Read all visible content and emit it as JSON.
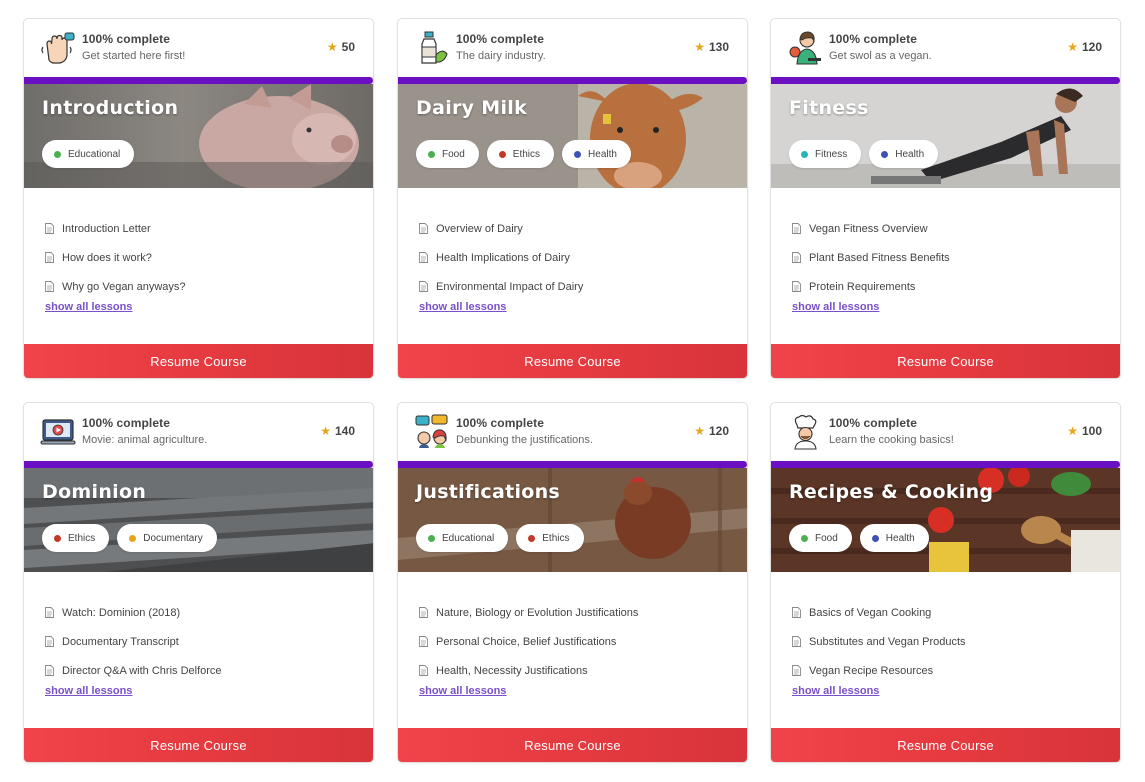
{
  "colors": {
    "progress": "#6b0fc2",
    "resume_button": "#e53a40",
    "star": "#e8a317",
    "link": "#7a4fc9",
    "tag_dots": {
      "Educational": "#4caf50",
      "Food": "#4caf50",
      "Ethics": "#c0392b",
      "Health": "#3f51b5",
      "Fitness": "#26b5b5",
      "Documentary": "#e8a317"
    }
  },
  "courses": [
    {
      "icon": "waving-hand-icon",
      "complete_label": "100% complete",
      "progress": 1.0,
      "tagline": "Get started here first!",
      "rating": "50",
      "title": "Introduction",
      "image": "pig-photo",
      "tags": [
        "Educational"
      ],
      "lessons": [
        "Introduction Letter",
        "How does it work?",
        "Why go Vegan anyways?"
      ],
      "show_all": "show all lessons",
      "button": "Resume Course"
    },
    {
      "icon": "milk-bottle-icon",
      "complete_label": "100% complete",
      "progress": 1.0,
      "tagline": "The dairy industry.",
      "rating": "130",
      "title": "Dairy Milk",
      "image": "cow-photo",
      "tags": [
        "Food",
        "Ethics",
        "Health"
      ],
      "lessons": [
        "Overview of Dairy",
        "Health Implications of Dairy",
        "Environmental Impact of Dairy"
      ],
      "show_all": "show all lessons",
      "button": "Resume Course"
    },
    {
      "icon": "athlete-icon",
      "complete_label": "100% complete",
      "progress": 1.0,
      "tagline": "Get swol as a vegan.",
      "rating": "120",
      "title": "Fitness",
      "image": "plank-photo",
      "tags": [
        "Fitness",
        "Health"
      ],
      "lessons": [
        "Vegan Fitness Overview",
        "Plant Based Fitness Benefits",
        "Protein Requirements"
      ],
      "show_all": "show all lessons",
      "button": "Resume Course"
    },
    {
      "icon": "laptop-play-icon",
      "complete_label": "100% complete",
      "progress": 1.0,
      "tagline": "Movie: animal agriculture.",
      "rating": "140",
      "title": "Dominion",
      "image": "farm-sheds-photo",
      "tags": [
        "Ethics",
        "Documentary"
      ],
      "lessons": [
        "Watch: Dominion (2018)",
        "Documentary Transcript",
        "Director Q&A with Chris Delforce"
      ],
      "show_all": "show all lessons",
      "button": "Resume Course"
    },
    {
      "icon": "debate-people-icon",
      "complete_label": "100% complete",
      "progress": 1.0,
      "tagline": "Debunking the justifications.",
      "rating": "120",
      "title": "Justifications",
      "image": "hen-photo",
      "tags": [
        "Educational",
        "Ethics"
      ],
      "lessons": [
        "Nature, Biology or Evolution Justifications",
        "Personal Choice, Belief Justifications",
        "Health, Necessity Justifications"
      ],
      "show_all": "show all lessons",
      "button": "Resume Course"
    },
    {
      "icon": "chef-icon",
      "complete_label": "100% complete",
      "progress": 1.0,
      "tagline": "Learn the cooking basics!",
      "rating": "100",
      "title": "Recipes & Cooking",
      "image": "cooking-photo",
      "tags": [
        "Food",
        "Health"
      ],
      "lessons": [
        "Basics of Vegan Cooking",
        "Substitutes and Vegan Products",
        "Vegan Recipe Resources"
      ],
      "show_all": "show all lessons",
      "button": "Resume Course"
    }
  ]
}
